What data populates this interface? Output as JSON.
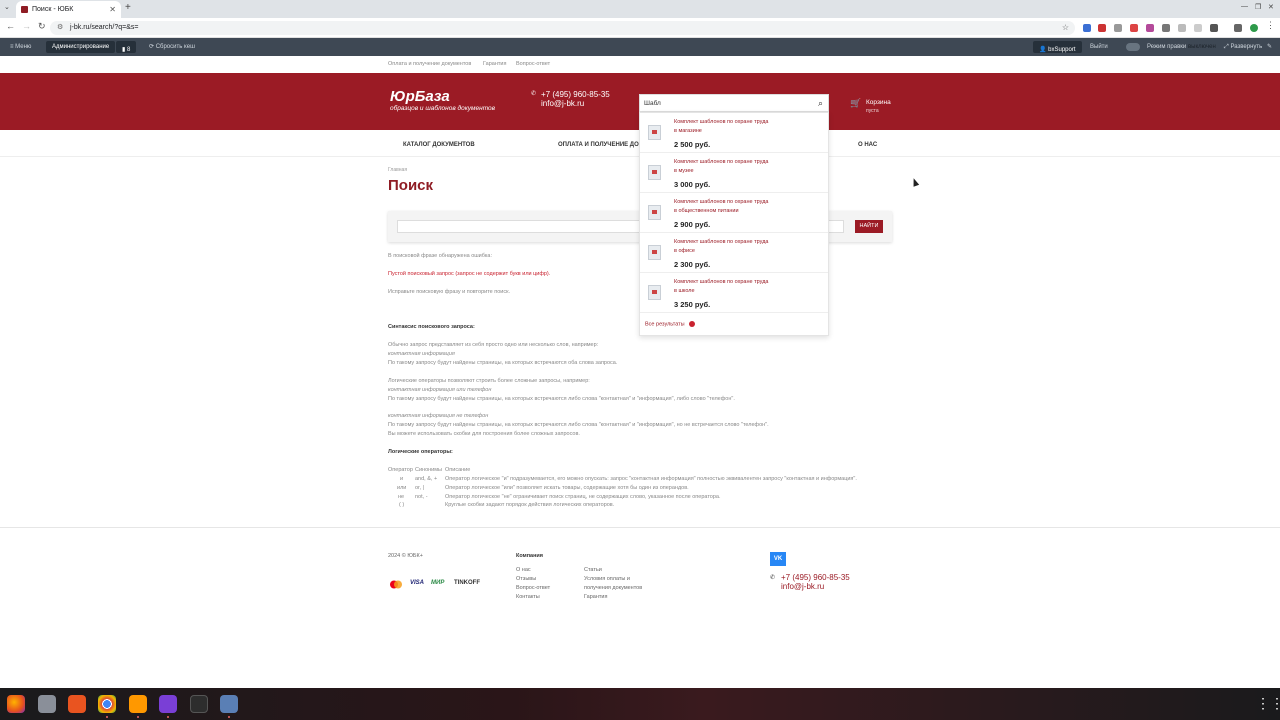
{
  "browser": {
    "tab_title": "Поиск - ЮБК",
    "url": "j-bk.ru/search/?q=&s="
  },
  "admin_bar": {
    "menu": "Меню",
    "administration": "Администрирование",
    "count": "8",
    "reset_cache": "Сбросить кеш",
    "support": "bxSupport",
    "logout": "Выйти",
    "edit_mode_label": "Режим правки",
    "edit_mode_state": "выключен",
    "expand": "Развернуть"
  },
  "top_nav": [
    "Оплата и получение документов",
    "Гарантия",
    "Вопрос-ответ"
  ],
  "header": {
    "logo_title": "ЮрБаза",
    "logo_subtitle": "образцов и шаблонов документов",
    "phone": "+7 (495) 960-85-35",
    "email": "info@j-bk.ru",
    "search_value": "Шабл",
    "cart_label": "Корзина",
    "cart_status": "пуста"
  },
  "main_nav": [
    "КАТАЛОГ ДОКУМЕНТОВ",
    "ОПЛАТА И ПОЛУЧЕНИЕ ДОК",
    "О НАС"
  ],
  "breadcrumb": "Главная",
  "page_title": "Поиск",
  "search_panel": {
    "button": "НАЙТИ"
  },
  "dropdown": {
    "items": [
      {
        "line1": "Комплект шаблонов по охране труда",
        "line2": "в магазине",
        "price": "2 500 руб."
      },
      {
        "line1": "Комплект шаблонов по охране труда",
        "line2": "в музее",
        "price": "3 000 руб."
      },
      {
        "line1": "Комплект шаблонов по охране труда",
        "line2": "в общественном питании",
        "price": "2 900 руб."
      },
      {
        "line1": "Комплект шаблонов по охране труда",
        "line2": "в офисе",
        "price": "2 300 руб."
      },
      {
        "line1": "Комплект шаблонов по охране труда",
        "line2": "в школе",
        "price": "3 250 руб."
      }
    ],
    "all_results": "Все результаты"
  },
  "content": {
    "error_intro": "В поисковой фразе обнаружена ошибка:",
    "error": "Пустой поисковый запрос (запрос не содержит букв или цифр).",
    "fix": "Исправьте поисковую фразу и повторите поиск.",
    "syntax_title": "Синтаксис поискового запроса:",
    "s1": "Обычно запрос представляет из себя просто одно или несколько слов, например:",
    "s2": "контактная информация",
    "s3": "По такому запросу будут найдены страницы, на которых встречаются оба слова запроса.",
    "s4": "Логические операторы позволяют строить более сложные запросы, например:",
    "s5": "контактная информация или телефон",
    "s6": "По такому запросу будут найдены страницы, на которых встречаются либо слова \"контактная\" и \"информация\", либо слово \"телефон\".",
    "s7": "контактная информация не телефон",
    "s8": "По такому запросу будут найдены страницы, на которых встречаются либо слова \"контактная\" и \"информация\", но не встречается слово \"телефон\".",
    "s9": "Вы можете использовать скобки для построения более сложных запросов.",
    "ops_title": "Логические операторы:",
    "ops_header": [
      "Оператор",
      "Синонимы",
      "Описание"
    ],
    "ops_rows": [
      {
        "op": "и",
        "syn": "and, &, +",
        "desc": "Оператор логическое \"и\" подразумевается, его можно опускать: запрос \"контактная информация\" полностью эквивалентен запросу \"контактная и информация\"."
      },
      {
        "op": "или",
        "syn": "or, |",
        "desc": "Оператор логическое \"или\" позволяет искать товары, содержащие хотя бы один из операндов."
      },
      {
        "op": "не",
        "syn": "not, -",
        "desc": "Оператор логическое \"не\" ограничивает поиск страниц, не содержащих слово, указанное после оператора."
      },
      {
        "op": "( )",
        "syn": "",
        "desc": "Круглые скобки задают порядок действия логических операторов."
      }
    ]
  },
  "footer": {
    "copyright": "2024 © ЮБК+",
    "company_title": "Компания",
    "col1": [
      "О нас",
      "Отзывы",
      "Вопрос-ответ",
      "Контакты"
    ],
    "col2": [
      "Статьи",
      "Условия оплаты и",
      "получения документов",
      "Гарантия"
    ],
    "payments": [
      "VISA",
      "МИР",
      "TINKOFF"
    ],
    "vk": "VK",
    "phone": "+7 (495) 960-85-35",
    "email": "info@j-bk.ru"
  }
}
